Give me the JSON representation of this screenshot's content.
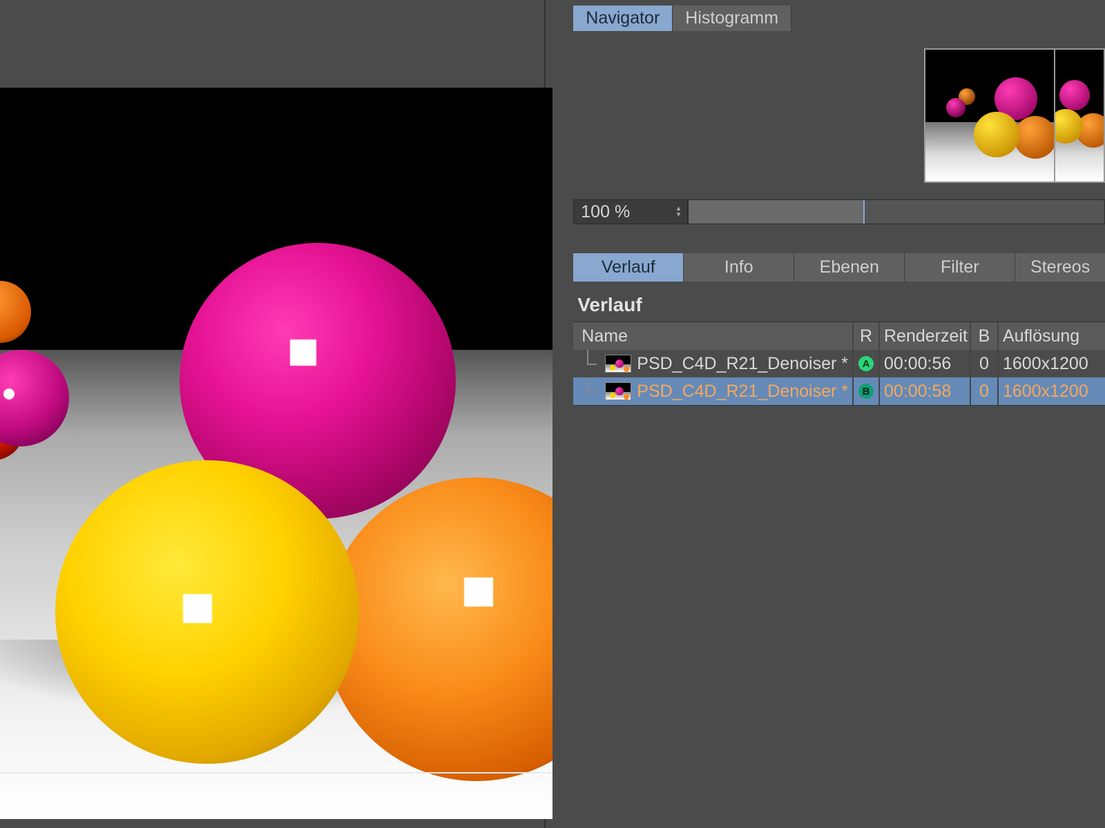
{
  "top_tabs": {
    "navigator": "Navigator",
    "histogram": "Histogramm"
  },
  "zoom": {
    "value": "100 %"
  },
  "mid_tabs": {
    "verlauf": "Verlauf",
    "info": "Info",
    "ebenen": "Ebenen",
    "filter": "Filter",
    "stereos": "Stereos"
  },
  "section_title": "Verlauf",
  "columns": {
    "name": "Name",
    "r": "R",
    "renderzeit": "Renderzeit",
    "b": "B",
    "aufloesung": "Auflösung"
  },
  "rows": [
    {
      "name": "PSD_C4D_R21_Denoiser *",
      "badge": "A",
      "renderzeit": "00:00:56",
      "b": "0",
      "aufloesung": "1600x1200",
      "selected": false
    },
    {
      "name": "PSD_C4D_R21_Denoiser *",
      "badge": "B",
      "renderzeit": "00:00:58",
      "b": "0",
      "aufloesung": "1600x1200",
      "selected": true
    }
  ]
}
